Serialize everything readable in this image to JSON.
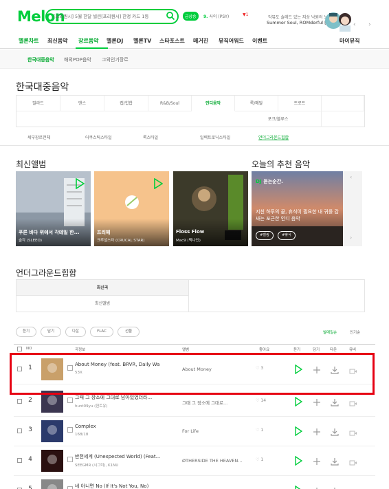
{
  "header": {
    "logo": "Melon",
    "search_text": "[프리퀀시] 5월 한달 빌린[프리퀀시] 한정 카드 1등",
    "badge": "급상승",
    "rank_num": "9.",
    "rank_text": "사이 (PSY)",
    "rank_change": "▼1",
    "promo_line1": "악뮤도 솔레드 있는 지상 낙원의 노래",
    "promo_line2": "Summer Soul, ROMderful [UTOPIA]",
    "prev": "‹",
    "next": "›"
  },
  "nav": {
    "items": [
      "멜론차트",
      "최신음악",
      "장르음악",
      "멜론DJ",
      "멜론TV",
      "스타포스트",
      "매거진",
      "뮤직어워드",
      "이벤트",
      "마이뮤직"
    ],
    "active_index": 2
  },
  "subnav": {
    "items": [
      "한국대중음악",
      "해외POP음악",
      "그외인기장르"
    ]
  },
  "page_title": "한국대중음악",
  "genres": {
    "row1": [
      "발라드",
      "댄스",
      "랩/힙합",
      "R&B/Soul",
      "인디음악",
      "록/메탈",
      "트로트"
    ],
    "row2": [
      "포크/블루스"
    ],
    "active": "인디음악"
  },
  "substyles": {
    "items": [
      "세부장르전체",
      "어쿠스틱스타일",
      "록스타일",
      "일렉트로닉스타일",
      "언더그라운드힙합"
    ],
    "active": "언더그라운드힙합"
  },
  "latest": {
    "title": "최신앨범",
    "albums": [
      {
        "title": "푸른 바다 위에서 각테일 한...",
        "artist": "술칵 (SLEEO)",
        "color": "#9aa7b8"
      },
      {
        "title": "프리헤",
        "artist": "크루셜스타 (CRUCAL STAR)",
        "color": "#f5c48f"
      },
      {
        "title": "Floss Flow",
        "artist": "Mac9 (맥나인)",
        "color": "#3a3a2a"
      }
    ]
  },
  "recommend": {
    "title": "오늘의 추천 음악",
    "dj_label": "DJ",
    "dj_name": "듣는순간.",
    "desc": "지친 하루의 끝, 휴식이 필요한 내 귀를 감싸는 포근한 인디 음악",
    "tags": [
      "#힐링",
      "#휴식"
    ],
    "prev": "‹",
    "next": "›"
  },
  "underground": {
    "title": "언더그라운드힙합",
    "tabs": [
      "최신곡",
      "최신앨범"
    ],
    "active": "최신곡"
  },
  "toolbar": {
    "buttons": [
      "듣기",
      "담기",
      "다운",
      "FLAC",
      "선물"
    ],
    "sorts": [
      "발매일순",
      "인기순"
    ],
    "active_sort": "발매일순"
  },
  "table": {
    "headers": [
      "NO",
      "곡정보",
      "앨범",
      "좋아요",
      "듣기",
      "담기",
      "다운",
      "뮤비"
    ]
  },
  "songs": [
    {
      "rank": "1",
      "title": "About Money (feat. BRVR, Daily Wa...",
      "artist": "53X",
      "album": "About Money",
      "likes": "3",
      "color": "#c9a06a"
    },
    {
      "rank": "2",
      "title": "그때 그 장소에 그대로 남아있었더라...",
      "artist": "hunt09yu (헌트유)",
      "album": "그때 그 장소에 그대로...",
      "likes": "14",
      "color": "#3b3650"
    },
    {
      "rank": "3",
      "title": "Complex",
      "artist": "168/18",
      "album": "For Life",
      "likes": "1",
      "color": "#2b3a6b"
    },
    {
      "rank": "4",
      "title": "반전세계 (Unexpected World) (Feat...",
      "artist": "SEEGMR (시그미), K1NU",
      "album": "ØTHERSIDE THE HEAVEN...",
      "likes": "1",
      "color": "#2a1010"
    },
    {
      "rank": "5",
      "title": "네 아니면 No (If It's Not You, No)",
      "artist": "",
      "album": "",
      "likes": "",
      "color": "#888888"
    }
  ],
  "colors": {
    "brand": "#00cd3c",
    "highlight": "#e60012"
  }
}
